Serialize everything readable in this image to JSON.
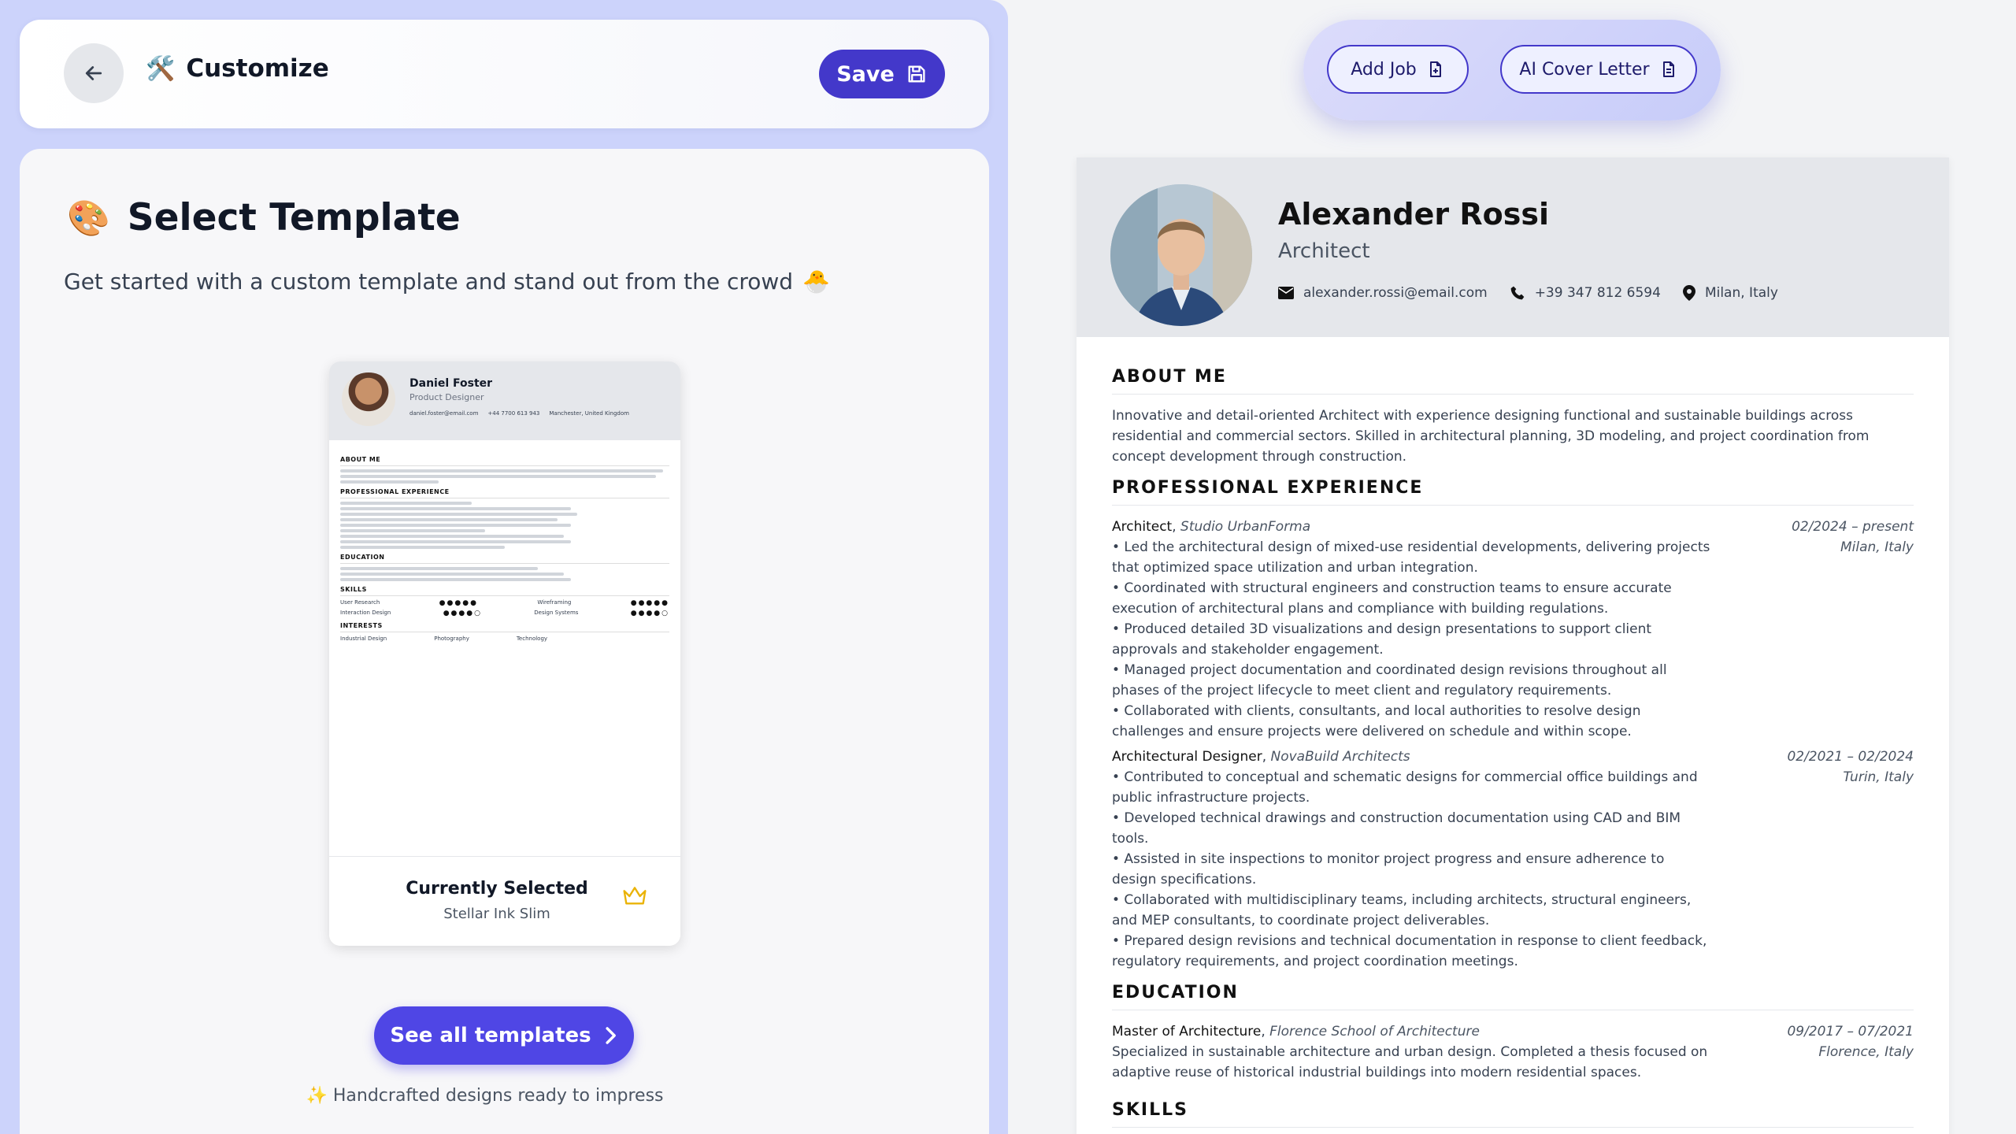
{
  "header": {
    "title_emoji": "🛠️",
    "title": "Customize",
    "save_label": "Save"
  },
  "template_panel": {
    "emoji": "🎨",
    "title": "Select Template",
    "subtitle": "Get started with a custom template and stand out from the crowd",
    "subtitle_emoji": "🐣",
    "preview": {
      "name": "Daniel Foster",
      "role": "Product Designer",
      "email": "daniel.foster@email.com",
      "phone": "+44 7700 613 943",
      "location": "Manchester, United Kingdom",
      "sections": [
        "ABOUT ME",
        "PROFESSIONAL EXPERIENCE",
        "EDUCATION",
        "SKILLS",
        "INTERESTS"
      ],
      "skills": [
        "User Research",
        "Wireframing",
        "Interaction Design",
        "Design Systems"
      ],
      "interests": [
        "Industrial Design",
        "Photography",
        "Technology"
      ]
    },
    "current_label": "Currently Selected",
    "current_template": "Stellar Ink Slim",
    "see_all_label": "See all templates",
    "handcrafted_emoji": "✨",
    "handcrafted_text": "Handcrafted designs ready to impress"
  },
  "actions": {
    "add_job": "Add Job",
    "ai_cover_letter": "AI Cover Letter"
  },
  "resume": {
    "name": "Alexander Rossi",
    "role": "Architect",
    "email": "alexander.rossi@email.com",
    "phone": "+39 347 812 6594",
    "location": "Milan, Italy",
    "about_title": "ABOUT ME",
    "about": "Innovative and detail-oriented Architect with experience designing functional and sustainable buildings across residential and commercial sectors. Skilled in architectural planning, 3D modeling, and project coordination from concept development through construction.",
    "experience_title": "PROFESSIONAL EXPERIENCE",
    "jobs": [
      {
        "title": "Architect",
        "company": "Studio UrbanForma",
        "dates": "02/2024 – present",
        "location": "Milan, Italy",
        "bullets": [
          "• Led the architectural design of mixed-use residential developments, delivering projects that optimized space utilization and urban integration.",
          "• Coordinated with structural engineers and construction teams to ensure accurate execution of architectural plans and compliance with building regulations.",
          "• Produced detailed 3D visualizations and design presentations to support client approvals and stakeholder engagement.",
          "• Managed project documentation and coordinated design revisions throughout all phases of the project lifecycle to meet client and regulatory requirements.",
          "• Collaborated with clients, consultants, and local authorities to resolve design challenges and ensure projects were delivered on schedule and within scope."
        ]
      },
      {
        "title": "Architectural Designer",
        "company": "NovaBuild Architects",
        "dates": "02/2021 – 02/2024",
        "location": "Turin, Italy",
        "bullets": [
          "• Contributed to conceptual and schematic designs for commercial office buildings and public infrastructure projects.",
          "• Developed technical drawings and construction documentation using CAD and BIM tools.",
          "• Assisted in site inspections to monitor project progress and ensure adherence to design specifications.",
          "• Collaborated with multidisciplinary teams, including architects, structural engineers, and MEP consultants, to coordinate project deliverables.",
          "• Prepared design revisions and technical documentation in response to client feedback, regulatory requirements, and project coordination meetings."
        ]
      }
    ],
    "education_title": "EDUCATION",
    "education": {
      "degree": "Master of Architecture",
      "school": "Florence School of Architecture",
      "dates": "09/2017 – 07/2021",
      "location": "Florence, Italy",
      "description": "Specialized in sustainable architecture and urban design. Completed a thesis focused on adaptive reuse of historical industrial buildings into modern residential spaces."
    },
    "skills_title": "SKILLS"
  }
}
